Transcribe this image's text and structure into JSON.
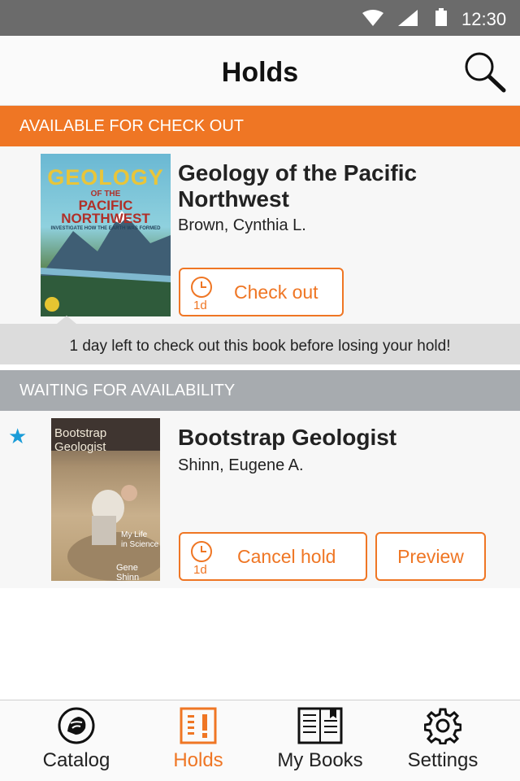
{
  "status_bar": {
    "time": "12:30"
  },
  "header": {
    "title": "Holds"
  },
  "sections": {
    "available": {
      "title": "AVAILABLE FOR CHECK OUT"
    },
    "waiting": {
      "title": "WAITING FOR AVAILABILITY"
    }
  },
  "available_book": {
    "title": "Geology of the Pacific Northwest",
    "author": "Brown, Cynthia L.",
    "cover_text": {
      "top": "GEOLOGY",
      "sub": "OF THE",
      "main1": "PACIFIC",
      "main2": "NORTHWEST",
      "tagline": "INVESTIGATE HOW THE EARTH WAS FORMED"
    },
    "button_label": "Check out",
    "days": "1d",
    "notice": "1 day left to check out this book before losing your hold!"
  },
  "waiting_book": {
    "title": "Bootstrap Geologist",
    "author": "Shinn, Eugene A.",
    "cover_text": {
      "title": "Bootstrap Geologist",
      "subtitle1": "My Life",
      "subtitle2": "in Science",
      "author": "Gene Shinn"
    },
    "cancel_label": "Cancel hold",
    "preview_label": "Preview",
    "days": "1d"
  },
  "tabs": [
    {
      "label": "Catalog",
      "icon": "lion-icon"
    },
    {
      "label": "Holds",
      "icon": "holds-icon"
    },
    {
      "label": "My Books",
      "icon": "book-icon"
    },
    {
      "label": "Settings",
      "icon": "gear-icon"
    }
  ],
  "colors": {
    "accent": "#ef7624",
    "star": "#1a9cd8",
    "statusbar": "#6b6b6b",
    "waiting_header": "#a7abaf"
  }
}
